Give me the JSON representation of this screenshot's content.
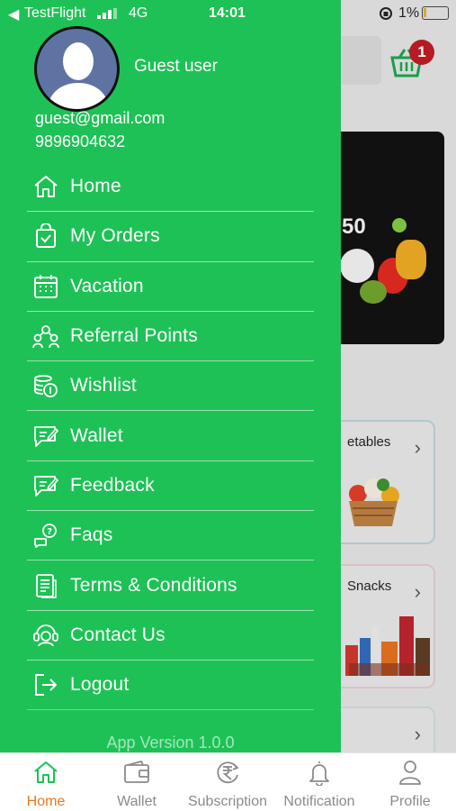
{
  "status_bar": {
    "back_glyph": "◀",
    "carrier": "TestFlight",
    "network": "4G",
    "time": "14:01",
    "battery_percent": "1%"
  },
  "background": {
    "cart_badge": "1",
    "banner_number": "50",
    "cards": [
      {
        "title": "etables"
      },
      {
        "title": "Snacks"
      },
      {
        "title": ""
      }
    ]
  },
  "drawer": {
    "user_name": "Guest user",
    "email": "guest@gmail.com",
    "phone": "9896904632",
    "menu": [
      {
        "label": "Home",
        "icon": "home-icon"
      },
      {
        "label": "My Orders",
        "icon": "orders-bag-icon"
      },
      {
        "label": "Vacation",
        "icon": "calendar-icon"
      },
      {
        "label": "Referral Points",
        "icon": "referral-icon"
      },
      {
        "label": "Wishlist",
        "icon": "coins-icon"
      },
      {
        "label": "Wallet",
        "icon": "wallet-icon"
      },
      {
        "label": "Feedback",
        "icon": "feedback-icon"
      },
      {
        "label": "Faqs",
        "icon": "faq-icon"
      },
      {
        "label": "Terms & Conditions",
        "icon": "document-icon"
      },
      {
        "label": "Contact Us",
        "icon": "contact-support-icon"
      },
      {
        "label": "Logout",
        "icon": "logout-icon"
      }
    ],
    "app_version": "App Version 1.0.0"
  },
  "tabbar": {
    "tabs": [
      {
        "label": "Home",
        "icon": "home-icon",
        "active": true
      },
      {
        "label": "Wallet",
        "icon": "wallet-icon",
        "active": false
      },
      {
        "label": "Subscription",
        "icon": "rupee-cycle-icon",
        "active": false
      },
      {
        "label": "Notification",
        "icon": "bell-icon",
        "active": false
      },
      {
        "label": "Profile",
        "icon": "user-icon",
        "active": false
      }
    ]
  },
  "colors": {
    "drawer_green": "#1ec156",
    "active_tab": "#e8771f",
    "badge_red": "#b51b22"
  }
}
